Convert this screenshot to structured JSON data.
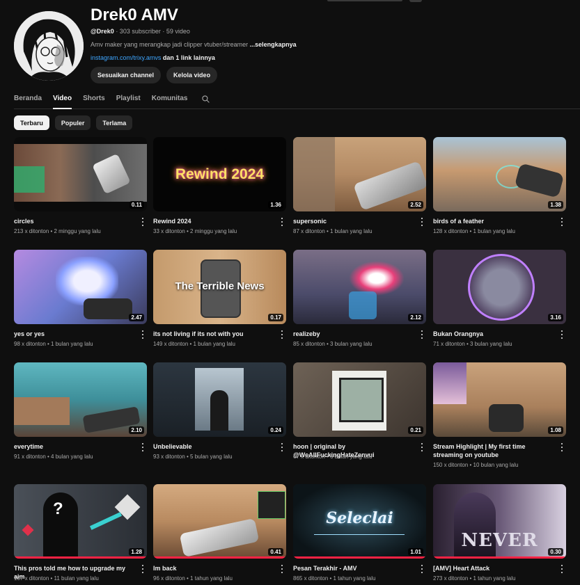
{
  "channel": {
    "name": "Drek0 AMV",
    "handle": "@Drek0",
    "stats": "· 303 subscriber · 59 video",
    "description": "Amv maker yang merangkap jadi clipper vtuber/streamer",
    "more": "...selengkapnya",
    "link": "instagram.com/trixy.amvs",
    "link_rest": "dan 1 link lainnya",
    "buttons": [
      "Sesuaikan channel",
      "Kelola video"
    ]
  },
  "tabs": [
    {
      "label": "Beranda"
    },
    {
      "label": "Video"
    },
    {
      "label": "Shorts"
    },
    {
      "label": "Playlist"
    },
    {
      "label": "Komunitas"
    }
  ],
  "active_tab": "Video",
  "chips": [
    {
      "label": "Terbaru"
    },
    {
      "label": "Populer"
    },
    {
      "label": "Terlama"
    }
  ],
  "active_chip": "Terbaru",
  "thumb_texts": {
    "rewind": "Rewind 2024",
    "terrible": "The Terrible News",
    "secret": "Seleclai",
    "never": "NEVER"
  },
  "videos": [
    {
      "title": "circles",
      "meta": "213 x ditonton • 2 minggu yang lalu",
      "duration": "0.11"
    },
    {
      "title": "Rewind 2024",
      "meta": "33 x ditonton • 2 minggu yang lalu",
      "duration": "1.36"
    },
    {
      "title": "supersonic",
      "meta": "87 x ditonton • 1 bulan yang lalu",
      "duration": "2.52"
    },
    {
      "title": "birds of a feather",
      "meta": "128 x ditonton • 1 bulan yang lalu",
      "duration": "1.38"
    },
    {
      "title": "yes or yes",
      "meta": "98 x ditonton • 1 bulan yang lalu",
      "duration": "2.47"
    },
    {
      "title": "its not living if its not with you",
      "meta": "149 x ditonton • 1 bulan yang lalu",
      "duration": "0.17"
    },
    {
      "title": "realizeby",
      "meta": "85 x ditonton • 3 bulan yang lalu",
      "duration": "2.12"
    },
    {
      "title": "Bukan Orangnya",
      "meta": "71 x ditonton • 3 bulan yang lalu",
      "duration": "3.16"
    },
    {
      "title": "everytime",
      "meta": "91 x ditonton • 4 bulan yang lalu",
      "duration": "2.10"
    },
    {
      "title": "Unbelievable",
      "meta": "93 x ditonton • 5 bulan yang lalu",
      "duration": "0.24"
    },
    {
      "title": "hoon | original by @WeAllFuckingHateZenvui",
      "meta": "67 x ditonton • 6 bulan yang lalu",
      "duration": "0.21"
    },
    {
      "title": "Stream Highlight | My first time streaming on youtube",
      "meta": "150 x ditonton • 10 bulan yang lalu",
      "duration": "1.08"
    },
    {
      "title": "This pros told me how to upgrade my aim",
      "meta": "107 x ditonton • 11 bulan yang lalu",
      "duration": "1.28"
    },
    {
      "title": "Im back",
      "meta": "96 x ditonton • 1 tahun yang lalu",
      "duration": "0.41"
    },
    {
      "title": "Pesan Terakhir - AMV",
      "meta": "865 x ditonton • 1 tahun yang lalu",
      "duration": "1.01"
    },
    {
      "title": "[AMV] Heart Attack",
      "meta": "273 x ditonton • 1 tahun yang lalu",
      "duration": "0.30"
    }
  ]
}
